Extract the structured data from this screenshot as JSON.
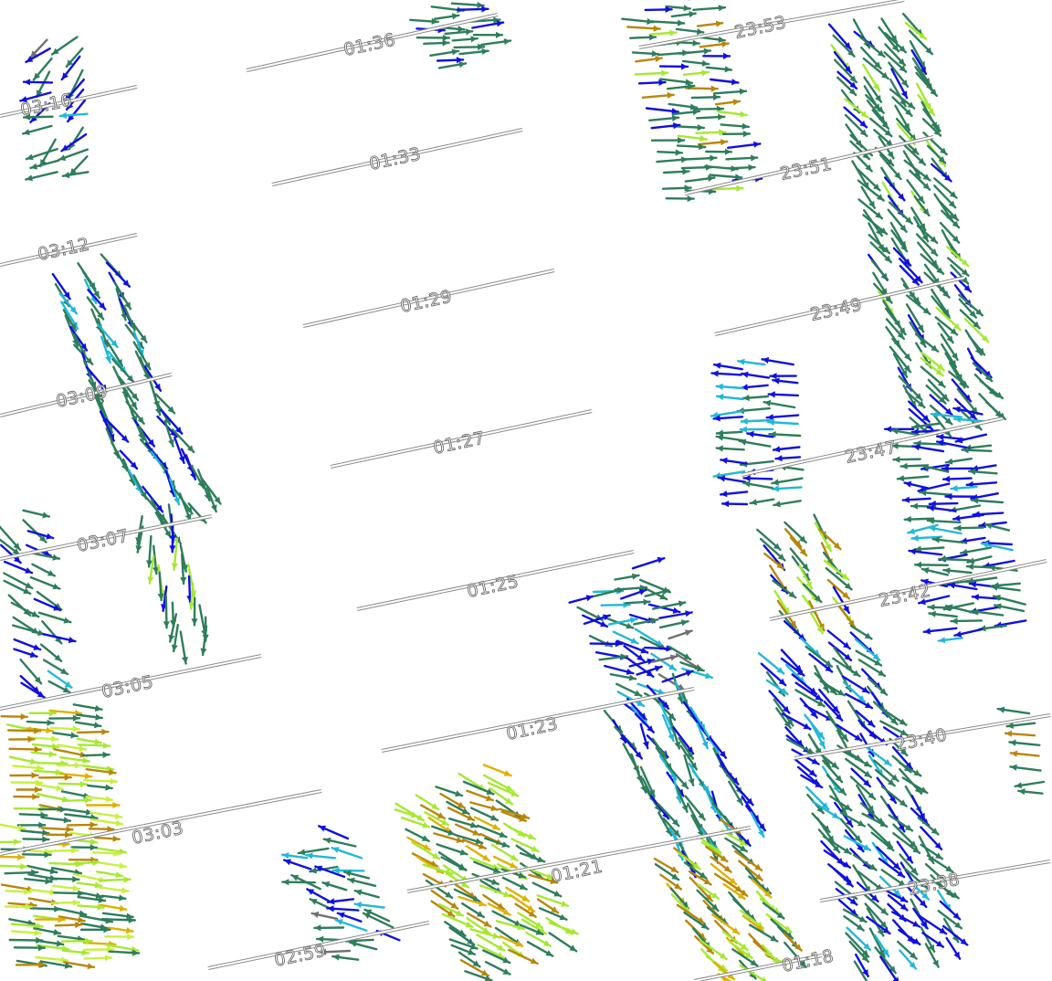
{
  "map": {
    "description_free": true,
    "track_time_labels": [
      {
        "id": "t0316",
        "text": "03:16"
      },
      {
        "id": "t0312",
        "text": "03:12"
      },
      {
        "id": "t0309",
        "text": "03:09"
      },
      {
        "id": "t0307",
        "text": "03:07"
      },
      {
        "id": "t0305",
        "text": "03:05"
      },
      {
        "id": "t0303",
        "text": "03:03"
      },
      {
        "id": "t0259",
        "text": "02:59"
      },
      {
        "id": "t0136",
        "text": "01:36"
      },
      {
        "id": "t0133",
        "text": "01:33"
      },
      {
        "id": "t0129",
        "text": "01:29"
      },
      {
        "id": "t0127",
        "text": "01:27"
      },
      {
        "id": "t0125",
        "text": "01:25"
      },
      {
        "id": "t0123",
        "text": "01:23"
      },
      {
        "id": "t0121",
        "text": "01:21"
      },
      {
        "id": "t0118",
        "text": "01:18"
      },
      {
        "id": "t2353",
        "text": "23:53"
      },
      {
        "id": "t2351",
        "text": "23:51"
      },
      {
        "id": "t2349",
        "text": "23:49"
      },
      {
        "id": "t2347",
        "text": "23:47"
      },
      {
        "id": "t2342",
        "text": "23:42"
      },
      {
        "id": "t2340",
        "text": "23:40"
      },
      {
        "id": "t2338",
        "text": "23:38"
      }
    ],
    "vector_colors": {
      "dark_green": "#2e7d5b",
      "blue": "#1010e0",
      "cyan": "#22b8d8",
      "lime": "#a6e832",
      "yellow_green": "#c8f040",
      "ochre": "#b8860b",
      "gold": "#e0b000",
      "gray": "#707070"
    }
  }
}
